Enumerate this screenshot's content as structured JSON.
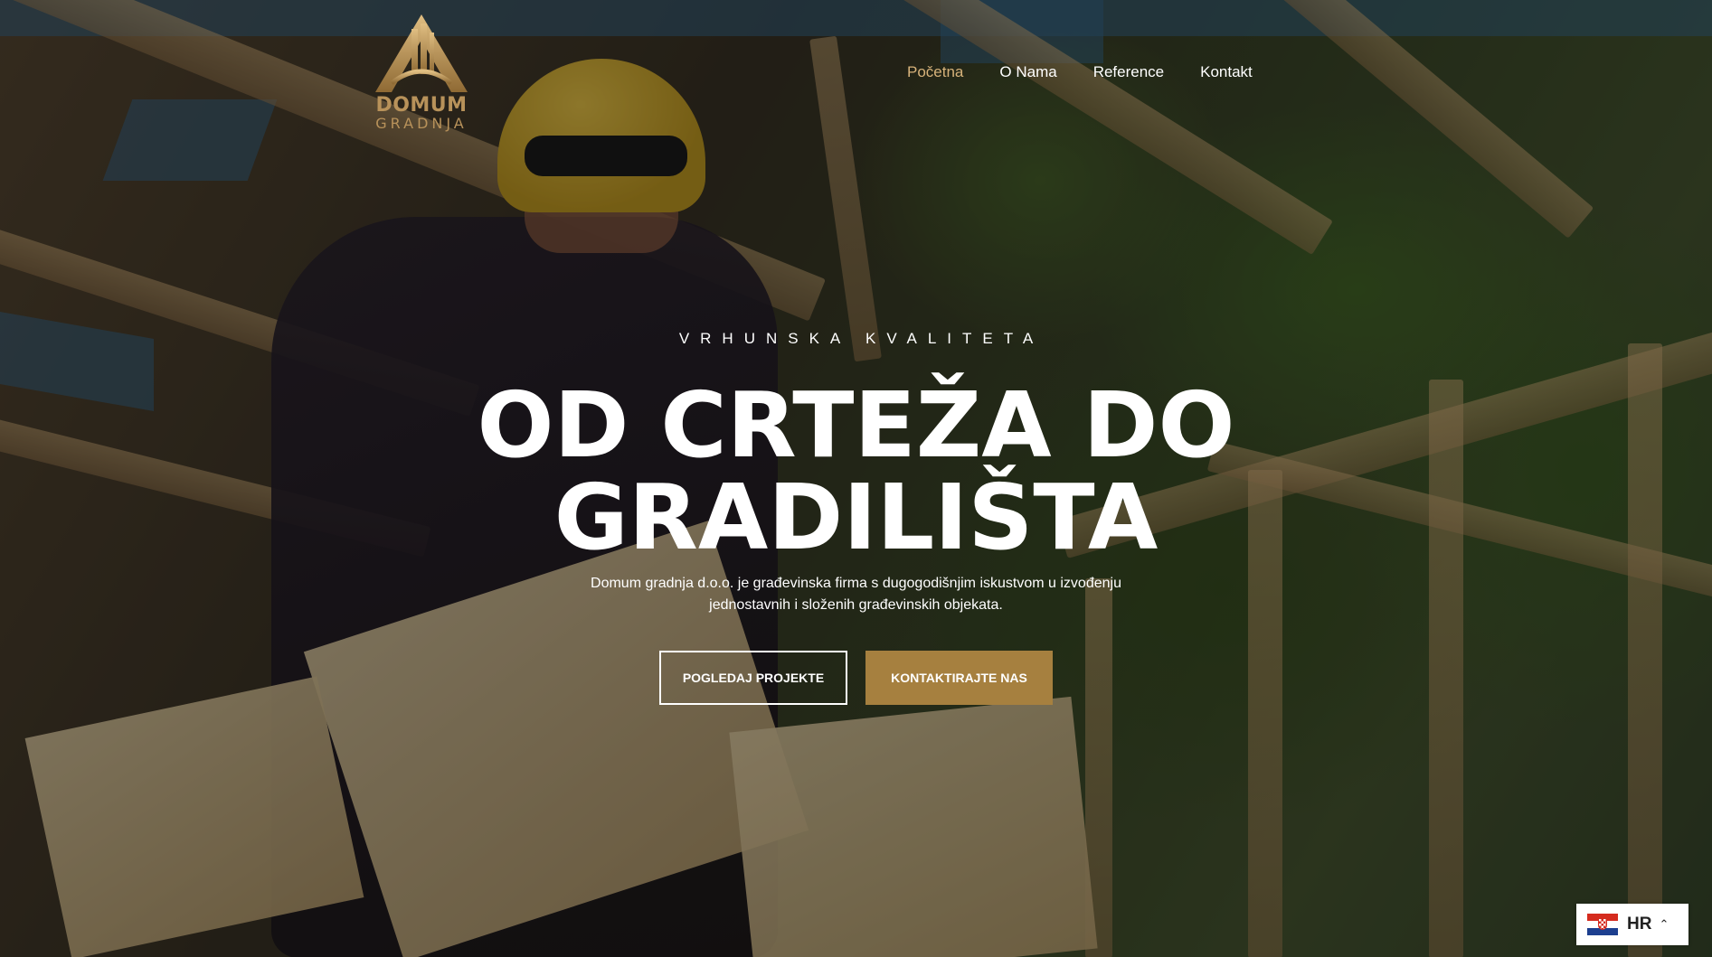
{
  "brand": {
    "name_line1": "DOMUM",
    "name_line2": "GRADNJA",
    "color": "#b8925a"
  },
  "nav": {
    "items": [
      {
        "label": "Početna",
        "active": true
      },
      {
        "label": "O Nama",
        "active": false
      },
      {
        "label": "Reference",
        "active": false
      },
      {
        "label": "Kontakt",
        "active": false
      }
    ],
    "active_color": "#d6b27a"
  },
  "hero": {
    "eyebrow": "VRHUNSKA KVALITETA",
    "headline_line1": "OD CRTEŽA DO",
    "headline_line2": "GRADILIŠTA",
    "subtitle": "Domum gradnja d.o.o. je građevinska firma s dugogodišnjim iskustvom u izvođenju jednostavnih i složenih građevinskih objekata.",
    "primary_button": "POGLEDAJ PROJEKTE",
    "secondary_button": "KONTAKTIRAJTE NAS",
    "accent_color": "#a6803f"
  },
  "language": {
    "code": "HR",
    "flag_icon": "croatia-flag-icon",
    "chevron_icon": "chevron-up-icon"
  }
}
